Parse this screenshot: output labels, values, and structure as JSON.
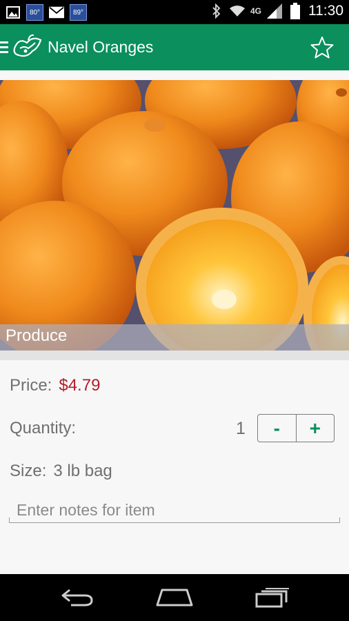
{
  "status_bar": {
    "time": "11:30",
    "temp_badges": [
      "80°",
      "89°"
    ],
    "network_label": "4G",
    "icons": [
      "image-icon",
      "weather-temp-icon",
      "mail-icon",
      "weather-temp-icon",
      "bluetooth-icon",
      "wifi-icon",
      "signal-icon",
      "battery-icon"
    ]
  },
  "app_bar": {
    "title": "Navel Oranges",
    "menu_icon": "hamburger-icon",
    "logo_icon": "brand-logo-icon",
    "favorite_icon": "star-outline-icon",
    "color": "#0a8f5d"
  },
  "product": {
    "image_subject": "oranges",
    "category": "Produce",
    "price_label": "Price:",
    "price": "$4.79",
    "price_color": "#b21e2a",
    "quantity_label": "Quantity:",
    "quantity": "1",
    "decrement_label": "-",
    "increment_label": "+",
    "size_label": "Size:",
    "size": "3 lb bag",
    "notes_value": "",
    "notes_placeholder": "Enter notes for item"
  },
  "nav_bar": {
    "buttons": [
      "back-icon",
      "home-icon",
      "recents-icon"
    ]
  }
}
